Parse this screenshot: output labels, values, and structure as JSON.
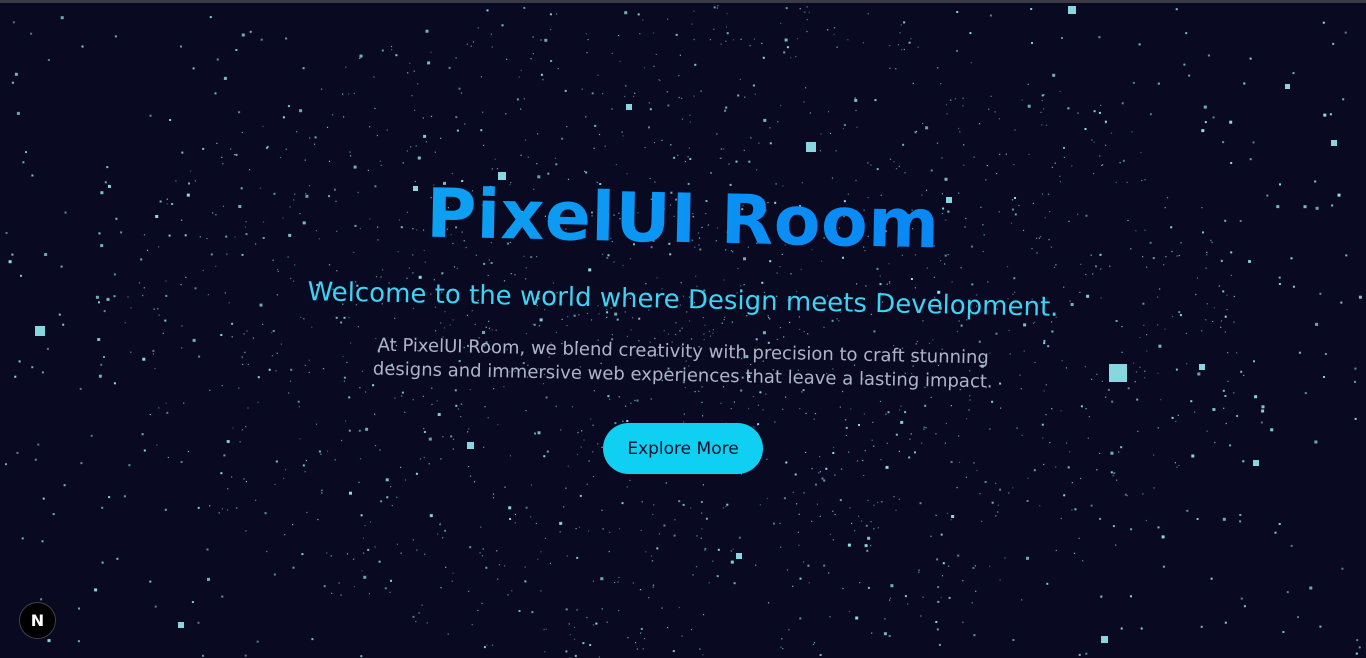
{
  "hero": {
    "title": "PixelUI Room",
    "subtitle": "Welcome to the world where Design meets Development.",
    "description": "At PixelUI Room, we blend creativity with precision to craft stunning designs and immersive web experiences that leave a lasting impact.",
    "cta_label": "Explore More"
  },
  "dev_badge": {
    "letter": "N"
  },
  "colors": {
    "background": "#090a22",
    "title_gradient_start": "#10b8ee",
    "title_gradient_end": "#0b76f0",
    "subtitle": "#3cd3f5",
    "description": "#aeb4c9",
    "cta_background": "#0fd0f3",
    "cta_text": "#0a0d2a",
    "stars": "#8de3ea"
  },
  "icons": {
    "dev_badge": "nextjs-logo-icon"
  }
}
